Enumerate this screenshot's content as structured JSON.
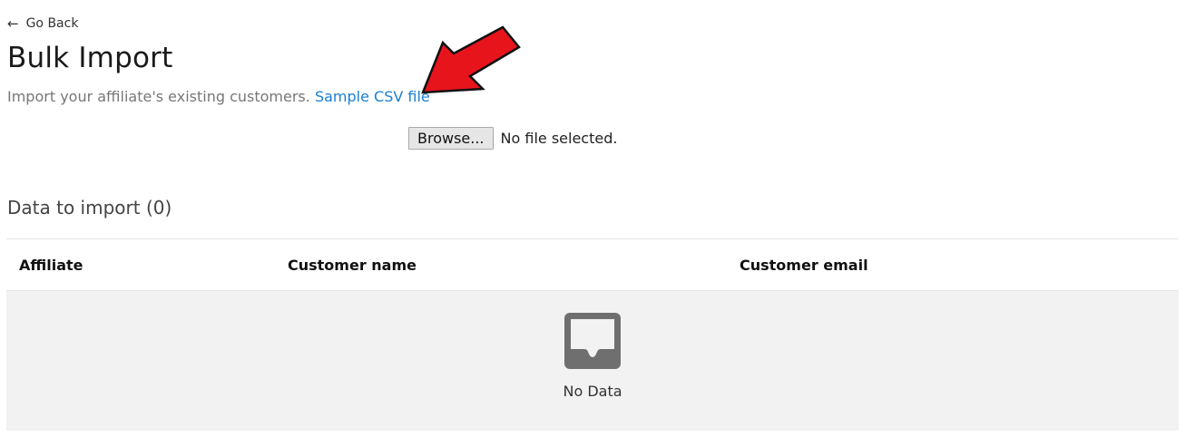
{
  "nav": {
    "back_label": "Go Back",
    "back_icon": "arrow-left-icon"
  },
  "page": {
    "title": "Bulk Import",
    "subtitle": "Import your affiliate's existing customers.",
    "sample_link": "Sample CSV file"
  },
  "file_input": {
    "button_label": "Browse...",
    "status": "No file selected."
  },
  "import_section": {
    "title": "Data to import (0)",
    "columns": [
      "Affiliate",
      "Customer name",
      "Customer email"
    ],
    "empty_icon": "inbox-icon",
    "empty_text": "No Data"
  },
  "annotation": {
    "arrow_color": "#e8141c",
    "icon": "red-arrow-annotation"
  },
  "colors": {
    "link": "#1a7fd0",
    "empty_bg": "#f2f2f2",
    "icon_gray": "#6f6f6f"
  }
}
